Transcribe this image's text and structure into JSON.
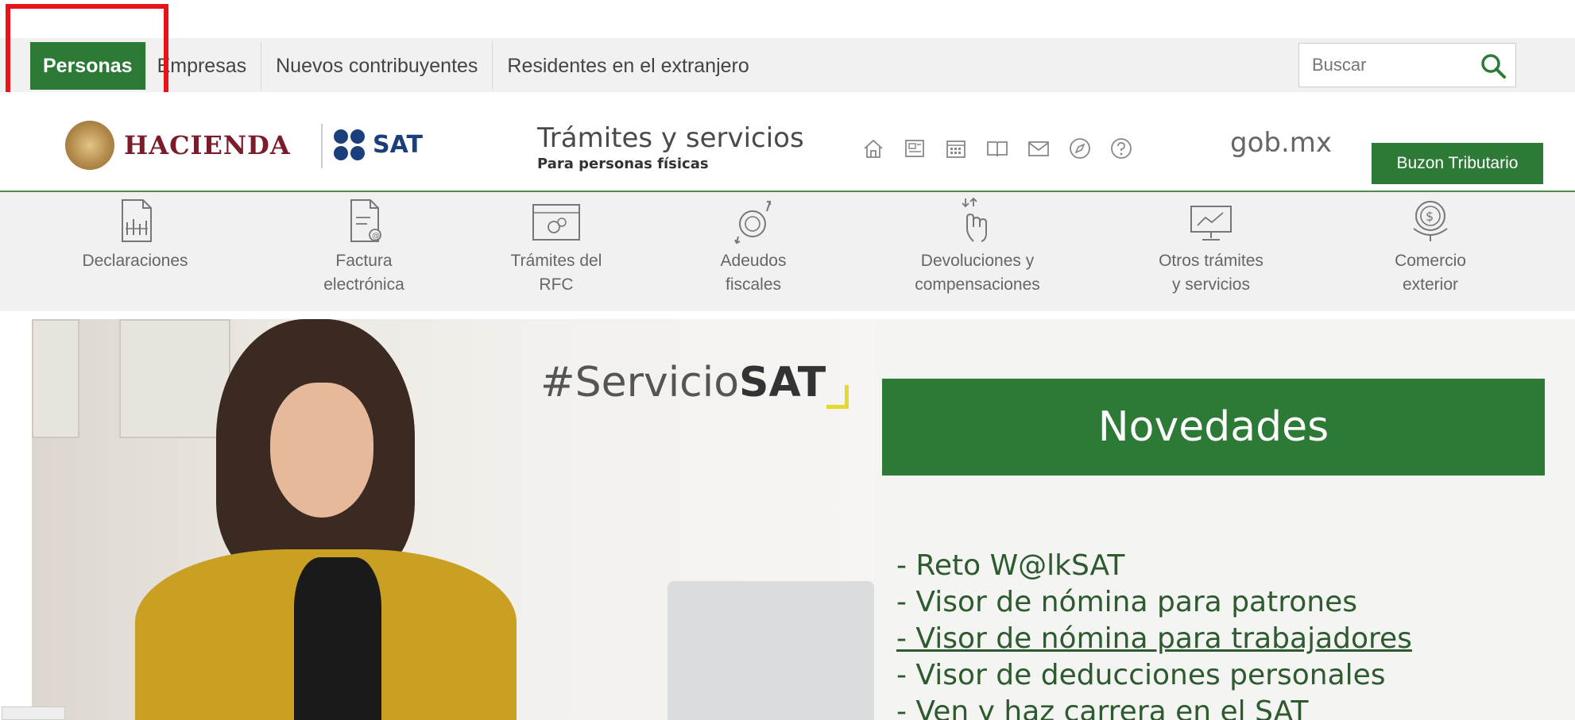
{
  "topnav": {
    "tabs": [
      {
        "label": "Personas",
        "active": true
      },
      {
        "label": "Empresas"
      },
      {
        "label": "Nuevos contribuyentes"
      },
      {
        "label": "Residentes en el extranjero"
      }
    ],
    "search_placeholder": "Buscar"
  },
  "header": {
    "hacienda": "HACIENDA",
    "sat": "SAT",
    "title": "Trámites y servicios",
    "subtitle": "Para personas físicas",
    "gob": "gob.mx",
    "buzon": "Buzon Tributario",
    "util_icons": [
      "home-icon",
      "document-icon",
      "calendar-icon",
      "book-icon",
      "mail-icon",
      "compass-icon",
      "help-icon"
    ]
  },
  "categories": [
    {
      "label": "Declaraciones",
      "icon": "declaraciones-icon"
    },
    {
      "label": "Factura\nelectrónica",
      "icon": "factura-icon"
    },
    {
      "label": "Trámites del\nRFC",
      "icon": "rfc-icon"
    },
    {
      "label": "Adeudos\nfiscales",
      "icon": "adeudos-icon"
    },
    {
      "label": "Devoluciones y\ncompensaciones",
      "icon": "devoluciones-icon"
    },
    {
      "label": "Otros trámites\ny servicios",
      "icon": "otros-tramites-icon"
    },
    {
      "label": "Comercio\nexterior",
      "icon": "comercio-exterior-icon"
    }
  ],
  "hero": {
    "hashtag_prefix": "#Servicio",
    "hashtag_bold": "SAT",
    "novedades_title": "Novedades",
    "items": [
      "- Reto W@lkSAT",
      "- Visor de nómina para patrones",
      "- Visor de nómina para trabajadores",
      "- Visor de deducciones personales",
      "- Ven y haz carrera en el SAT"
    ]
  },
  "colors": {
    "accent": "#2d7a36",
    "highlight": "#e8141b"
  }
}
